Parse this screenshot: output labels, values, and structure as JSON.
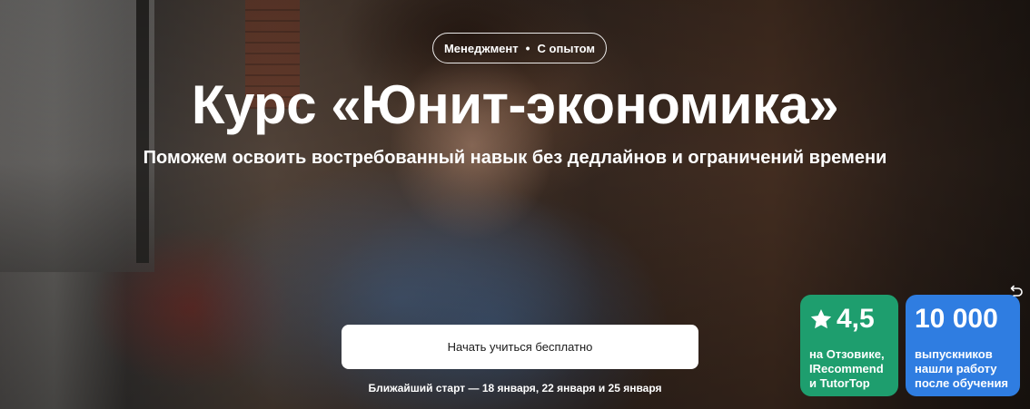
{
  "hero": {
    "tags": [
      "Менеджмент",
      "С опытом"
    ],
    "title": "Курс «Юнит-экономика»",
    "subtitle": "Поможем освоить востребованный навык без дедлайнов и ограничений времени",
    "cta_label": "Начать учиться бесплатно",
    "start_dates": "Ближайший старт — 18 января, 22 января и 25 января"
  },
  "badges": {
    "rating": {
      "value": "4,5",
      "icon": "star-icon",
      "caption_lines": [
        "на Отзовике,",
        "IRecommend",
        "и TutorTop"
      ],
      "color": "#1e9e6e"
    },
    "graduates": {
      "value": "10 000",
      "caption_lines": [
        "выпускников",
        "нашли работу",
        "после обучения"
      ],
      "color": "#2f7de1"
    }
  },
  "icons": {
    "corner": "undo-arrow-icon"
  }
}
